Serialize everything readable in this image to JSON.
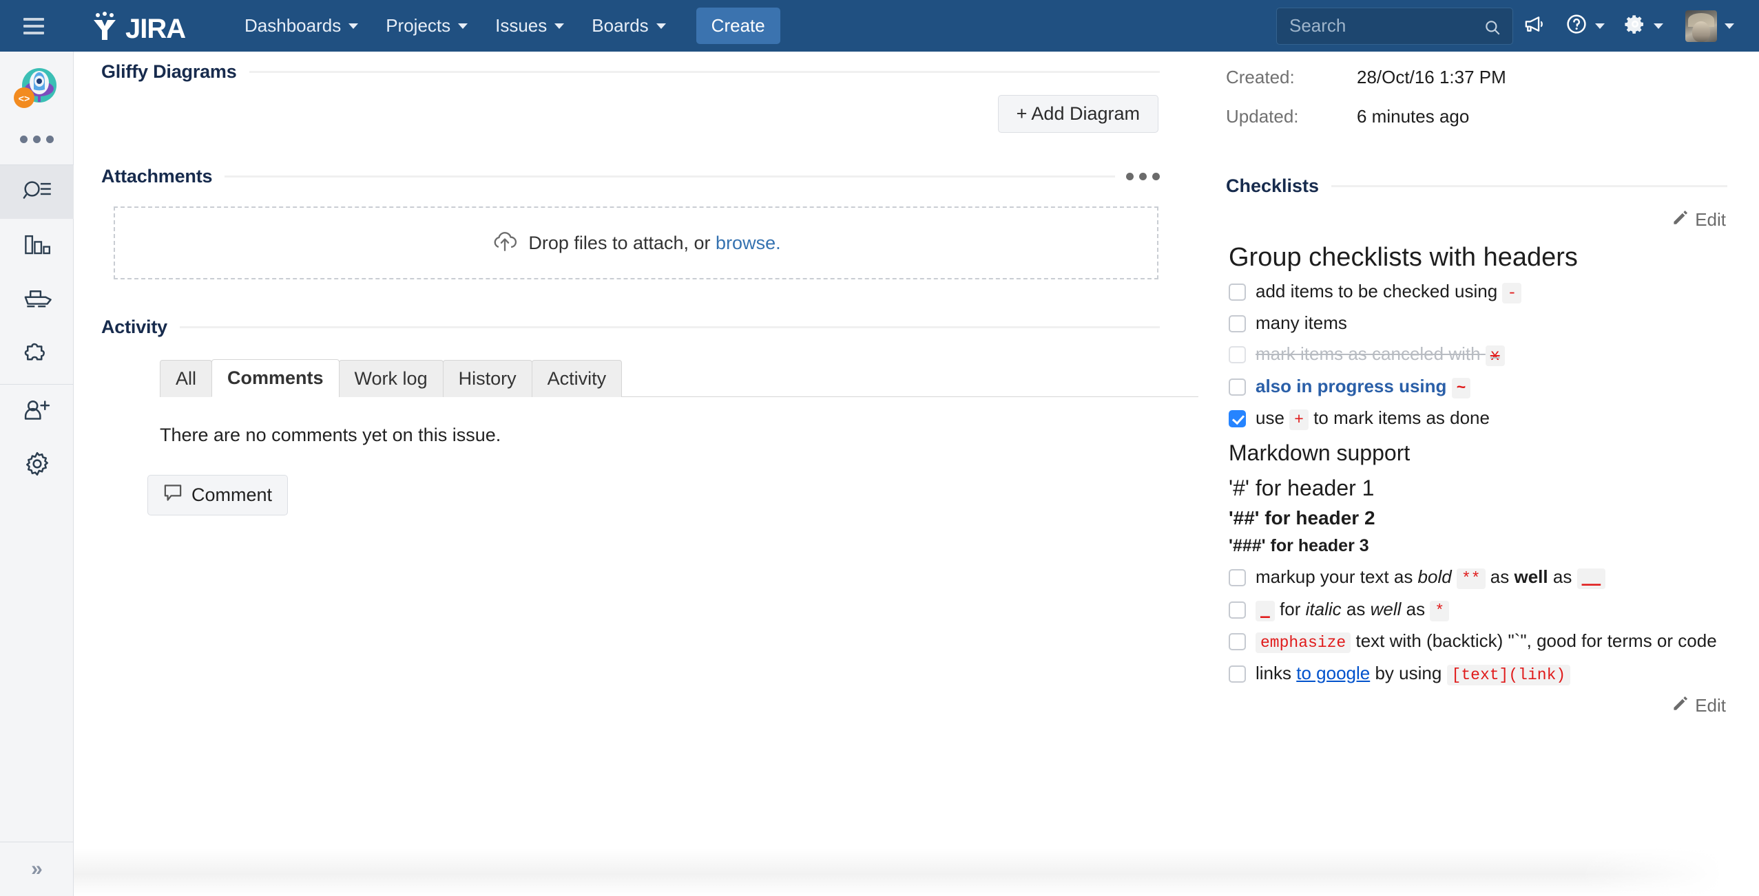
{
  "topnav": {
    "menu_icon": "hamburger-icon",
    "brand": "JIRA",
    "items": [
      {
        "label": "Dashboards",
        "has_caret": true
      },
      {
        "label": "Projects",
        "has_caret": true
      },
      {
        "label": "Issues",
        "has_caret": true
      },
      {
        "label": "Boards",
        "has_caret": true
      }
    ],
    "create_label": "Create",
    "search": {
      "placeholder": "Search",
      "value": "",
      "icon": "search-icon"
    },
    "icons": [
      "megaphone-icon",
      "help-icon",
      "settings-gear-icon",
      "user-avatar"
    ]
  },
  "sidebar": {
    "project_avatar": "project-avatar-icon",
    "more_label": "more-options-dots",
    "items": [
      {
        "name": "issues",
        "icon": "search-list-icon",
        "active": true
      },
      {
        "name": "reports",
        "icon": "bar-chart-icon",
        "active": false
      },
      {
        "name": "releases",
        "icon": "ship-icon",
        "active": false
      },
      {
        "name": "add-ons",
        "icon": "puzzle-piece-icon",
        "active": false
      },
      {
        "name": "invite-people",
        "icon": "person-plus-icon",
        "active": false
      },
      {
        "name": "project-settings",
        "icon": "gear-icon",
        "active": false
      }
    ],
    "expand_label": "»"
  },
  "main": {
    "gliffy": {
      "title": "Gliffy Diagrams",
      "add_button": "+ Add Diagram"
    },
    "attachments": {
      "title": "Attachments",
      "menu": "attachments-options-dots",
      "dropzone_text": "Drop files to attach, or",
      "dropzone_link": "browse.",
      "upload_icon": "cloud-upload-icon"
    },
    "activity": {
      "title": "Activity",
      "tabs": [
        {
          "label": "All",
          "active": false
        },
        {
          "label": "Comments",
          "active": true
        },
        {
          "label": "Work log",
          "active": false
        },
        {
          "label": "History",
          "active": false
        },
        {
          "label": "Activity",
          "active": false
        }
      ],
      "empty_text": "There are no comments yet on this issue.",
      "comment_button": "Comment",
      "comment_icon": "speech-bubble-icon"
    }
  },
  "right": {
    "fields": [
      {
        "label": "Created:",
        "value": "28/Oct/16 1:37 PM"
      },
      {
        "label": "Updated:",
        "value": "6 minutes ago"
      }
    ],
    "checklists": {
      "title": "Checklists",
      "edit_top": "Edit",
      "edit_bottom": "Edit",
      "edit_icon": "pencil-icon",
      "header_1": "Group checklists with headers",
      "items_group1": [
        {
          "text_before": "add items to be checked using",
          "code": "-",
          "code_after": "",
          "state": "unchecked",
          "style": "normal"
        },
        {
          "text_before": "many items",
          "code": "",
          "code_after": "",
          "state": "unchecked",
          "style": "normal"
        },
        {
          "text_before": "mark items as canceled with",
          "code": "x",
          "code_after": "",
          "state": "unchecked",
          "style": "canceled"
        },
        {
          "text_before": "also in progress using",
          "code": "~",
          "code_after": "",
          "state": "unchecked",
          "style": "progress"
        },
        {
          "text_before": "use",
          "code": "+",
          "code_after": "to mark items as done",
          "state": "checked",
          "style": "normal"
        }
      ],
      "header_markdown": "Markdown support",
      "md_h1": "'#' for header 1",
      "md_h2": "'##' for header 2",
      "md_h3": "'###' for header 3",
      "item_markup": {
        "p1": "markup your text as",
        "em1": "bold",
        "code1": "**",
        "p2": "as",
        "em2": "well",
        "p3": "as",
        "code2": "__"
      },
      "item_italic": {
        "code1": "_",
        "p1": "for",
        "em1": "italic",
        "p2": "as",
        "em2": "well",
        "p3": "as",
        "code2": "*"
      },
      "item_emphasize": {
        "code1": "emphasize",
        "p1": "text with (backtick) \"`\", good for terms or code"
      },
      "item_link": {
        "p1": "links",
        "link": "to google",
        "p2": "by using",
        "code1": "[text](link)"
      }
    }
  },
  "colors": {
    "nav_bg": "#205081",
    "create_btn": "#3b73af",
    "link": "#3572b0",
    "code_text": "#e01b1b",
    "code_bg": "#f2f2f2",
    "checkbox_checked": "#2684ff",
    "progress_text": "#2a5fa8",
    "canceled_text": "#b8bcc2"
  }
}
